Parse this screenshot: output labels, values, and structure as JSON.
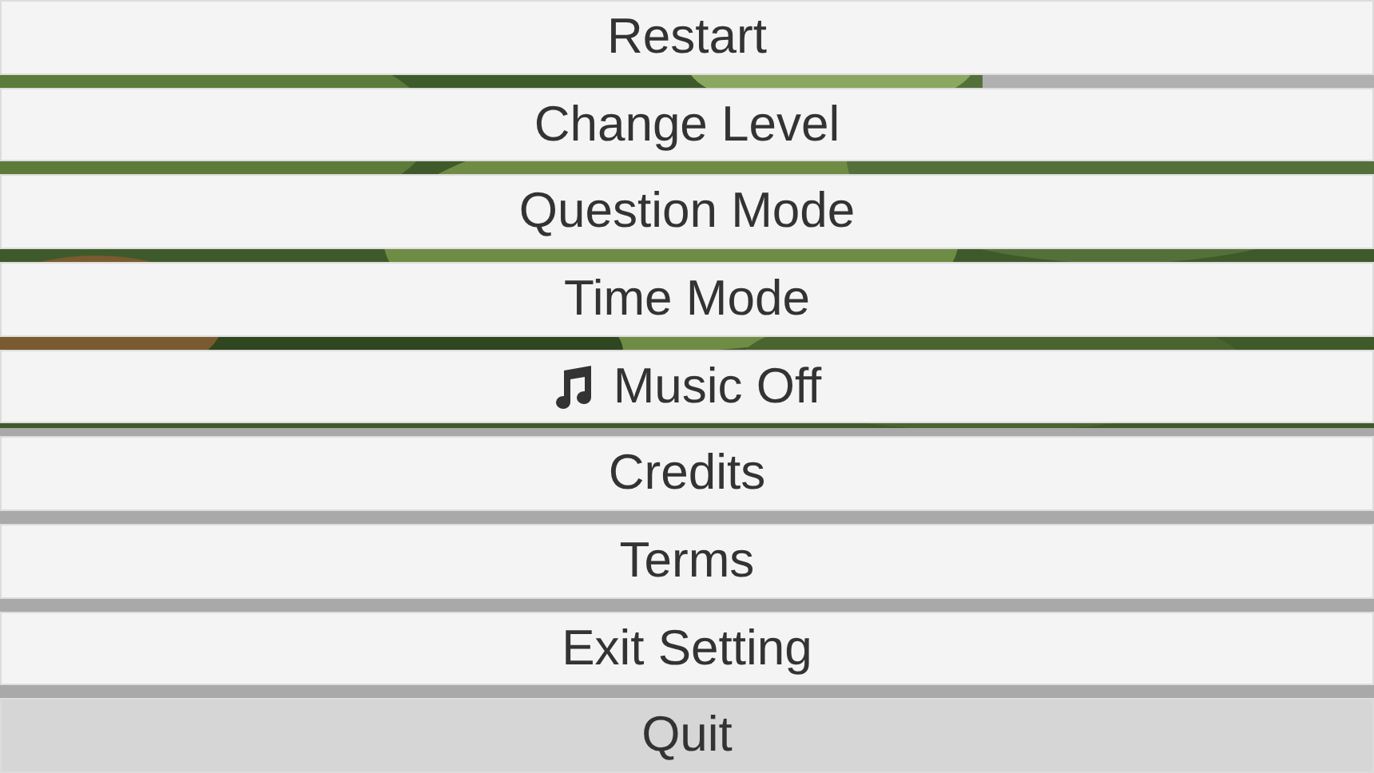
{
  "menu": [
    {
      "label": "Restart",
      "selected": false
    },
    {
      "label": "Change Level",
      "selected": false
    },
    {
      "label": "Question Mode",
      "selected": false
    },
    {
      "label": "Time Mode",
      "selected": false
    },
    {
      "label": "Music Off",
      "selected": false,
      "kind": "music"
    },
    {
      "label": "Credits",
      "selected": false
    },
    {
      "label": "Terms",
      "selected": false
    },
    {
      "label": "Exit Setting",
      "selected": false
    },
    {
      "label": "Quit",
      "selected": true
    }
  ]
}
